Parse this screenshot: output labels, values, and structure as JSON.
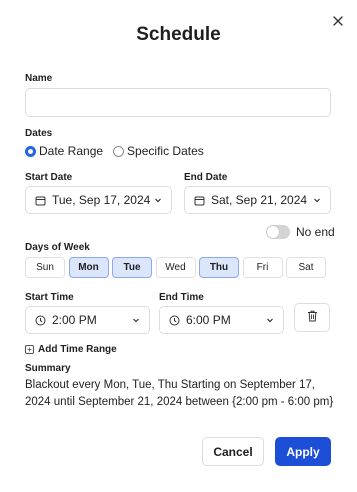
{
  "dialog": {
    "title": "Schedule",
    "close_icon": "close-icon"
  },
  "name": {
    "label": "Name",
    "value": "",
    "placeholder": ""
  },
  "dates": {
    "label": "Dates",
    "options": [
      {
        "label": "Date Range",
        "selected": true
      },
      {
        "label": "Specific Dates",
        "selected": false
      }
    ]
  },
  "start_date": {
    "label": "Start Date",
    "value": "Tue, Sep 17, 2024",
    "icon": "calendar-icon"
  },
  "end_date": {
    "label": "End Date",
    "value": "Sat, Sep 21, 2024",
    "icon": "calendar-icon"
  },
  "no_end": {
    "label": "No end",
    "enabled": false
  },
  "days_of_week": {
    "label": "Days of Week",
    "days": [
      {
        "label": "Sun",
        "selected": false
      },
      {
        "label": "Mon",
        "selected": true
      },
      {
        "label": "Tue",
        "selected": true
      },
      {
        "label": "Wed",
        "selected": false
      },
      {
        "label": "Thu",
        "selected": true
      },
      {
        "label": "Fri",
        "selected": false
      },
      {
        "label": "Sat",
        "selected": false
      }
    ]
  },
  "start_time": {
    "label": "Start Time",
    "value": "2:00 PM",
    "icon": "clock-icon"
  },
  "end_time": {
    "label": "End Time",
    "value": "6:00 PM",
    "icon": "clock-icon"
  },
  "add_time_range": {
    "label": "Add Time Range"
  },
  "summary": {
    "label": "Summary",
    "text": "Blackout every Mon, Tue, Thu Starting on September 17, 2024 until September 21, 2024 between {2:00 pm - 6:00 pm}"
  },
  "actions": {
    "cancel": "Cancel",
    "apply": "Apply"
  },
  "colors": {
    "accent": "#1d4ed8",
    "radio_selected": "#2563eb",
    "day_selected_bg": "#dbe6fb",
    "day_selected_border": "#8ea9e8"
  }
}
